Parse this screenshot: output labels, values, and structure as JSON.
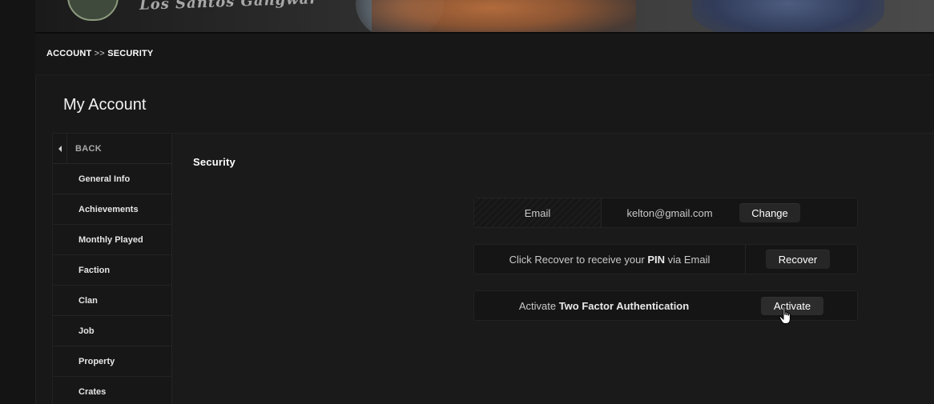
{
  "banner": {
    "logo_text": "Los Santos Gangwar"
  },
  "breadcrumb": {
    "section": "ACCOUNT",
    "separator": ">>",
    "page": "SECURITY"
  },
  "panel": {
    "title": "My Account"
  },
  "sidebar": {
    "back_label": "BACK",
    "items": [
      {
        "label": "General Info"
      },
      {
        "label": "Achievements"
      },
      {
        "label": "Monthly Played"
      },
      {
        "label": "Faction"
      },
      {
        "label": "Clan"
      },
      {
        "label": "Job"
      },
      {
        "label": "Property"
      },
      {
        "label": "Crates"
      }
    ]
  },
  "security": {
    "title": "Security",
    "email_row": {
      "label": "Email",
      "value": "kelton@gmail.com",
      "button": "Change"
    },
    "pin_row": {
      "text_before": "Click Recover to receive your",
      "text_bold": "PIN",
      "text_after": "via Email",
      "button": "Recover"
    },
    "twofa_row": {
      "text_before": "Activate",
      "text_bold": "Two Factor Authentication",
      "button": "Activate"
    }
  }
}
